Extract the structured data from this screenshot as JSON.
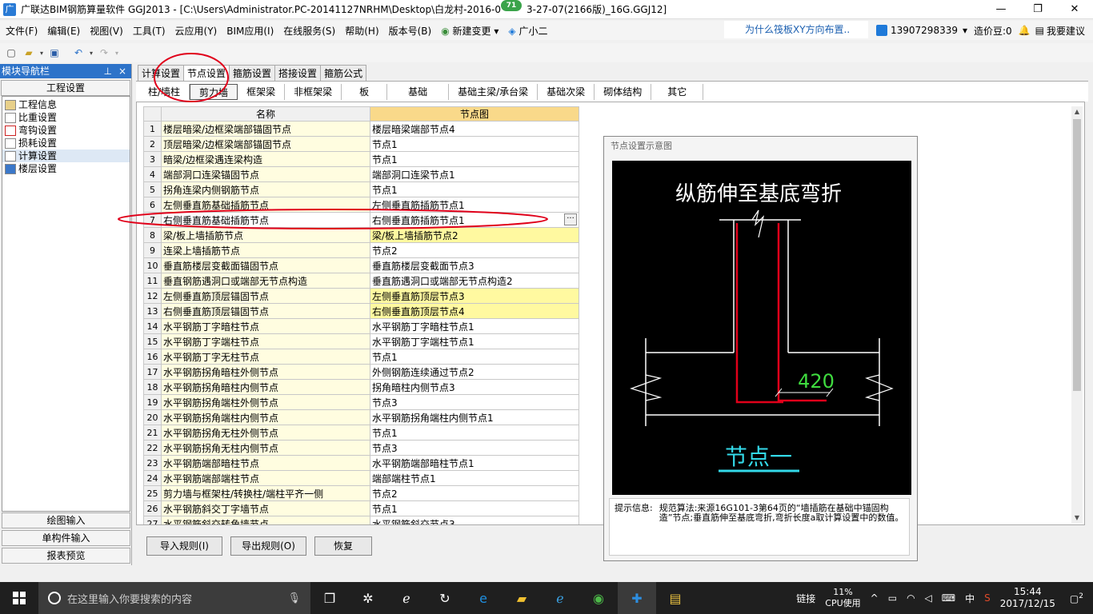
{
  "window": {
    "app_icon": "广",
    "title": "广联达BIM钢筋算量软件 GGJ2013 - [C:\\Users\\Administrator.PC-20141127NRHM\\Desktop\\白龙村-2016-0",
    "title_tail": "3-27-07(2166版)_16G.GGJ12]",
    "badge": "71",
    "min": "—",
    "max": "❐",
    "close": "✕"
  },
  "menu": {
    "items": [
      "文件(F)",
      "编辑(E)",
      "视图(V)",
      "工具(T)",
      "云应用(Y)",
      "BIM应用(I)",
      "在线服务(S)",
      "帮助(H)",
      "版本号(B)"
    ],
    "new_change": "新建变更",
    "new_change_arrow": "▾",
    "assistant": "广小二",
    "ad": "为什么筏板XY方向布置..",
    "phone": "13907298339",
    "phone_arrow": "▾",
    "coins": "造价豆:0",
    "suggest": "我要建议"
  },
  "nav": {
    "title": "模块导航栏",
    "pin": "⊥",
    "close": "×",
    "section": "工程设置",
    "items": [
      "工程信息",
      "比重设置",
      "弯钩设置",
      "损耗设置",
      "计算设置",
      "楼层设置"
    ],
    "bottom": [
      "绘图输入",
      "单构件输入",
      "报表预览"
    ]
  },
  "tabs": [
    "计算设置",
    "节点设置",
    "箍筋设置",
    "搭接设置",
    "箍筋公式"
  ],
  "subtabs": [
    "柱/墙柱",
    "剪力墙",
    "框架梁",
    "非框架梁",
    "板",
    "基础",
    "基础主梁/承台梁",
    "基础次梁",
    "砌体结构",
    "其它"
  ],
  "grid": {
    "headers": [
      "名称",
      "节点图"
    ],
    "ellipsis": "···",
    "rows": [
      {
        "n": "1",
        "name": "楼层暗梁/边框梁端部锚固节点",
        "node": "楼层暗梁端部节点4"
      },
      {
        "n": "2",
        "name": "顶层暗梁/边框梁端部锚固节点",
        "node": "节点1"
      },
      {
        "n": "3",
        "name": "暗梁/边框梁遇连梁构造",
        "node": "节点1"
      },
      {
        "n": "4",
        "name": "端部洞口连梁锚固节点",
        "node": "端部洞口连梁节点1"
      },
      {
        "n": "5",
        "name": "拐角连梁内侧钢筋节点",
        "node": "节点1"
      },
      {
        "n": "6",
        "name": "左侧垂直筋基础插筋节点",
        "node": "左侧垂直筋插筋节点1"
      },
      {
        "n": "7",
        "name": "右侧垂直筋基础插筋节点",
        "node": "右侧垂直筋插筋节点1"
      },
      {
        "n": "8",
        "name": "梁/板上墙插筋节点",
        "node": "梁/板上墙插筋节点2"
      },
      {
        "n": "9",
        "name": "连梁上墙插筋节点",
        "node": "节点2"
      },
      {
        "n": "10",
        "name": "垂直筋楼层变截面锚固节点",
        "node": "垂直筋楼层变截面节点3"
      },
      {
        "n": "11",
        "name": "垂直钢筋遇洞口或端部无节点构造",
        "node": "垂直筋遇洞口或端部无节点构造2"
      },
      {
        "n": "12",
        "name": "左侧垂直筋顶层锚固节点",
        "node": "左侧垂直筋顶层节点3"
      },
      {
        "n": "13",
        "name": "右侧垂直筋顶层锚固节点",
        "node": "右侧垂直筋顶层节点4"
      },
      {
        "n": "14",
        "name": "水平钢筋丁字暗柱节点",
        "node": "水平钢筋丁字暗柱节点1"
      },
      {
        "n": "15",
        "name": "水平钢筋丁字端柱节点",
        "node": "水平钢筋丁字端柱节点1"
      },
      {
        "n": "16",
        "name": "水平钢筋丁字无柱节点",
        "node": "节点1"
      },
      {
        "n": "17",
        "name": "水平钢筋拐角暗柱外侧节点",
        "node": "外侧钢筋连续通过节点2"
      },
      {
        "n": "18",
        "name": "水平钢筋拐角暗柱内侧节点",
        "node": "拐角暗柱内侧节点3"
      },
      {
        "n": "19",
        "name": "水平钢筋拐角端柱外侧节点",
        "node": "节点3"
      },
      {
        "n": "20",
        "name": "水平钢筋拐角端柱内侧节点",
        "node": "水平钢筋拐角端柱内侧节点1"
      },
      {
        "n": "21",
        "name": "水平钢筋拐角无柱外侧节点",
        "node": "节点1"
      },
      {
        "n": "22",
        "name": "水平钢筋拐角无柱内侧节点",
        "node": "节点3"
      },
      {
        "n": "23",
        "name": "水平钢筋端部暗柱节点",
        "node": "水平钢筋端部暗柱节点1"
      },
      {
        "n": "24",
        "name": "水平钢筋端部端柱节点",
        "node": "端部端柱节点1"
      },
      {
        "n": "25",
        "name": "剪力墙与框架柱/转换柱/端柱平齐一侧",
        "node": "节点2"
      },
      {
        "n": "26",
        "name": "水平钢筋斜交丁字墙节点",
        "node": "节点1"
      },
      {
        "n": "27",
        "name": "水平钢筋斜交转角墙节点",
        "node": "水平钢筋斜交节点3"
      }
    ]
  },
  "popup": {
    "title": "节点设置示意图",
    "diagram_title": "纵筋伸至基底弯折",
    "dimension": "420",
    "node_label": "节点一",
    "tip_label": "提示信息:",
    "tip_text": "规范算法:来源16G101-3第64页的“墙插筋在基础中锚固构造”节点;垂直筋伸至基底弯折,弯折长度a取计算设置中的数值。"
  },
  "buttons": {
    "import": "导入规则(I)",
    "export": "导出规则(O)",
    "restore": "恢复"
  },
  "taskbar": {
    "search_placeholder": "在这里输入你要搜索的内容",
    "link": "链接",
    "cpu_pct": "11%",
    "cpu_label": "CPU使用",
    "ime": "中",
    "time": "15:44",
    "date": "2017/12/15",
    "notif": "2"
  },
  "colors": {
    "accent": "#2d73c9",
    "highlight_yellow": "#fff9a0",
    "annotation_red": "#e0001a"
  }
}
